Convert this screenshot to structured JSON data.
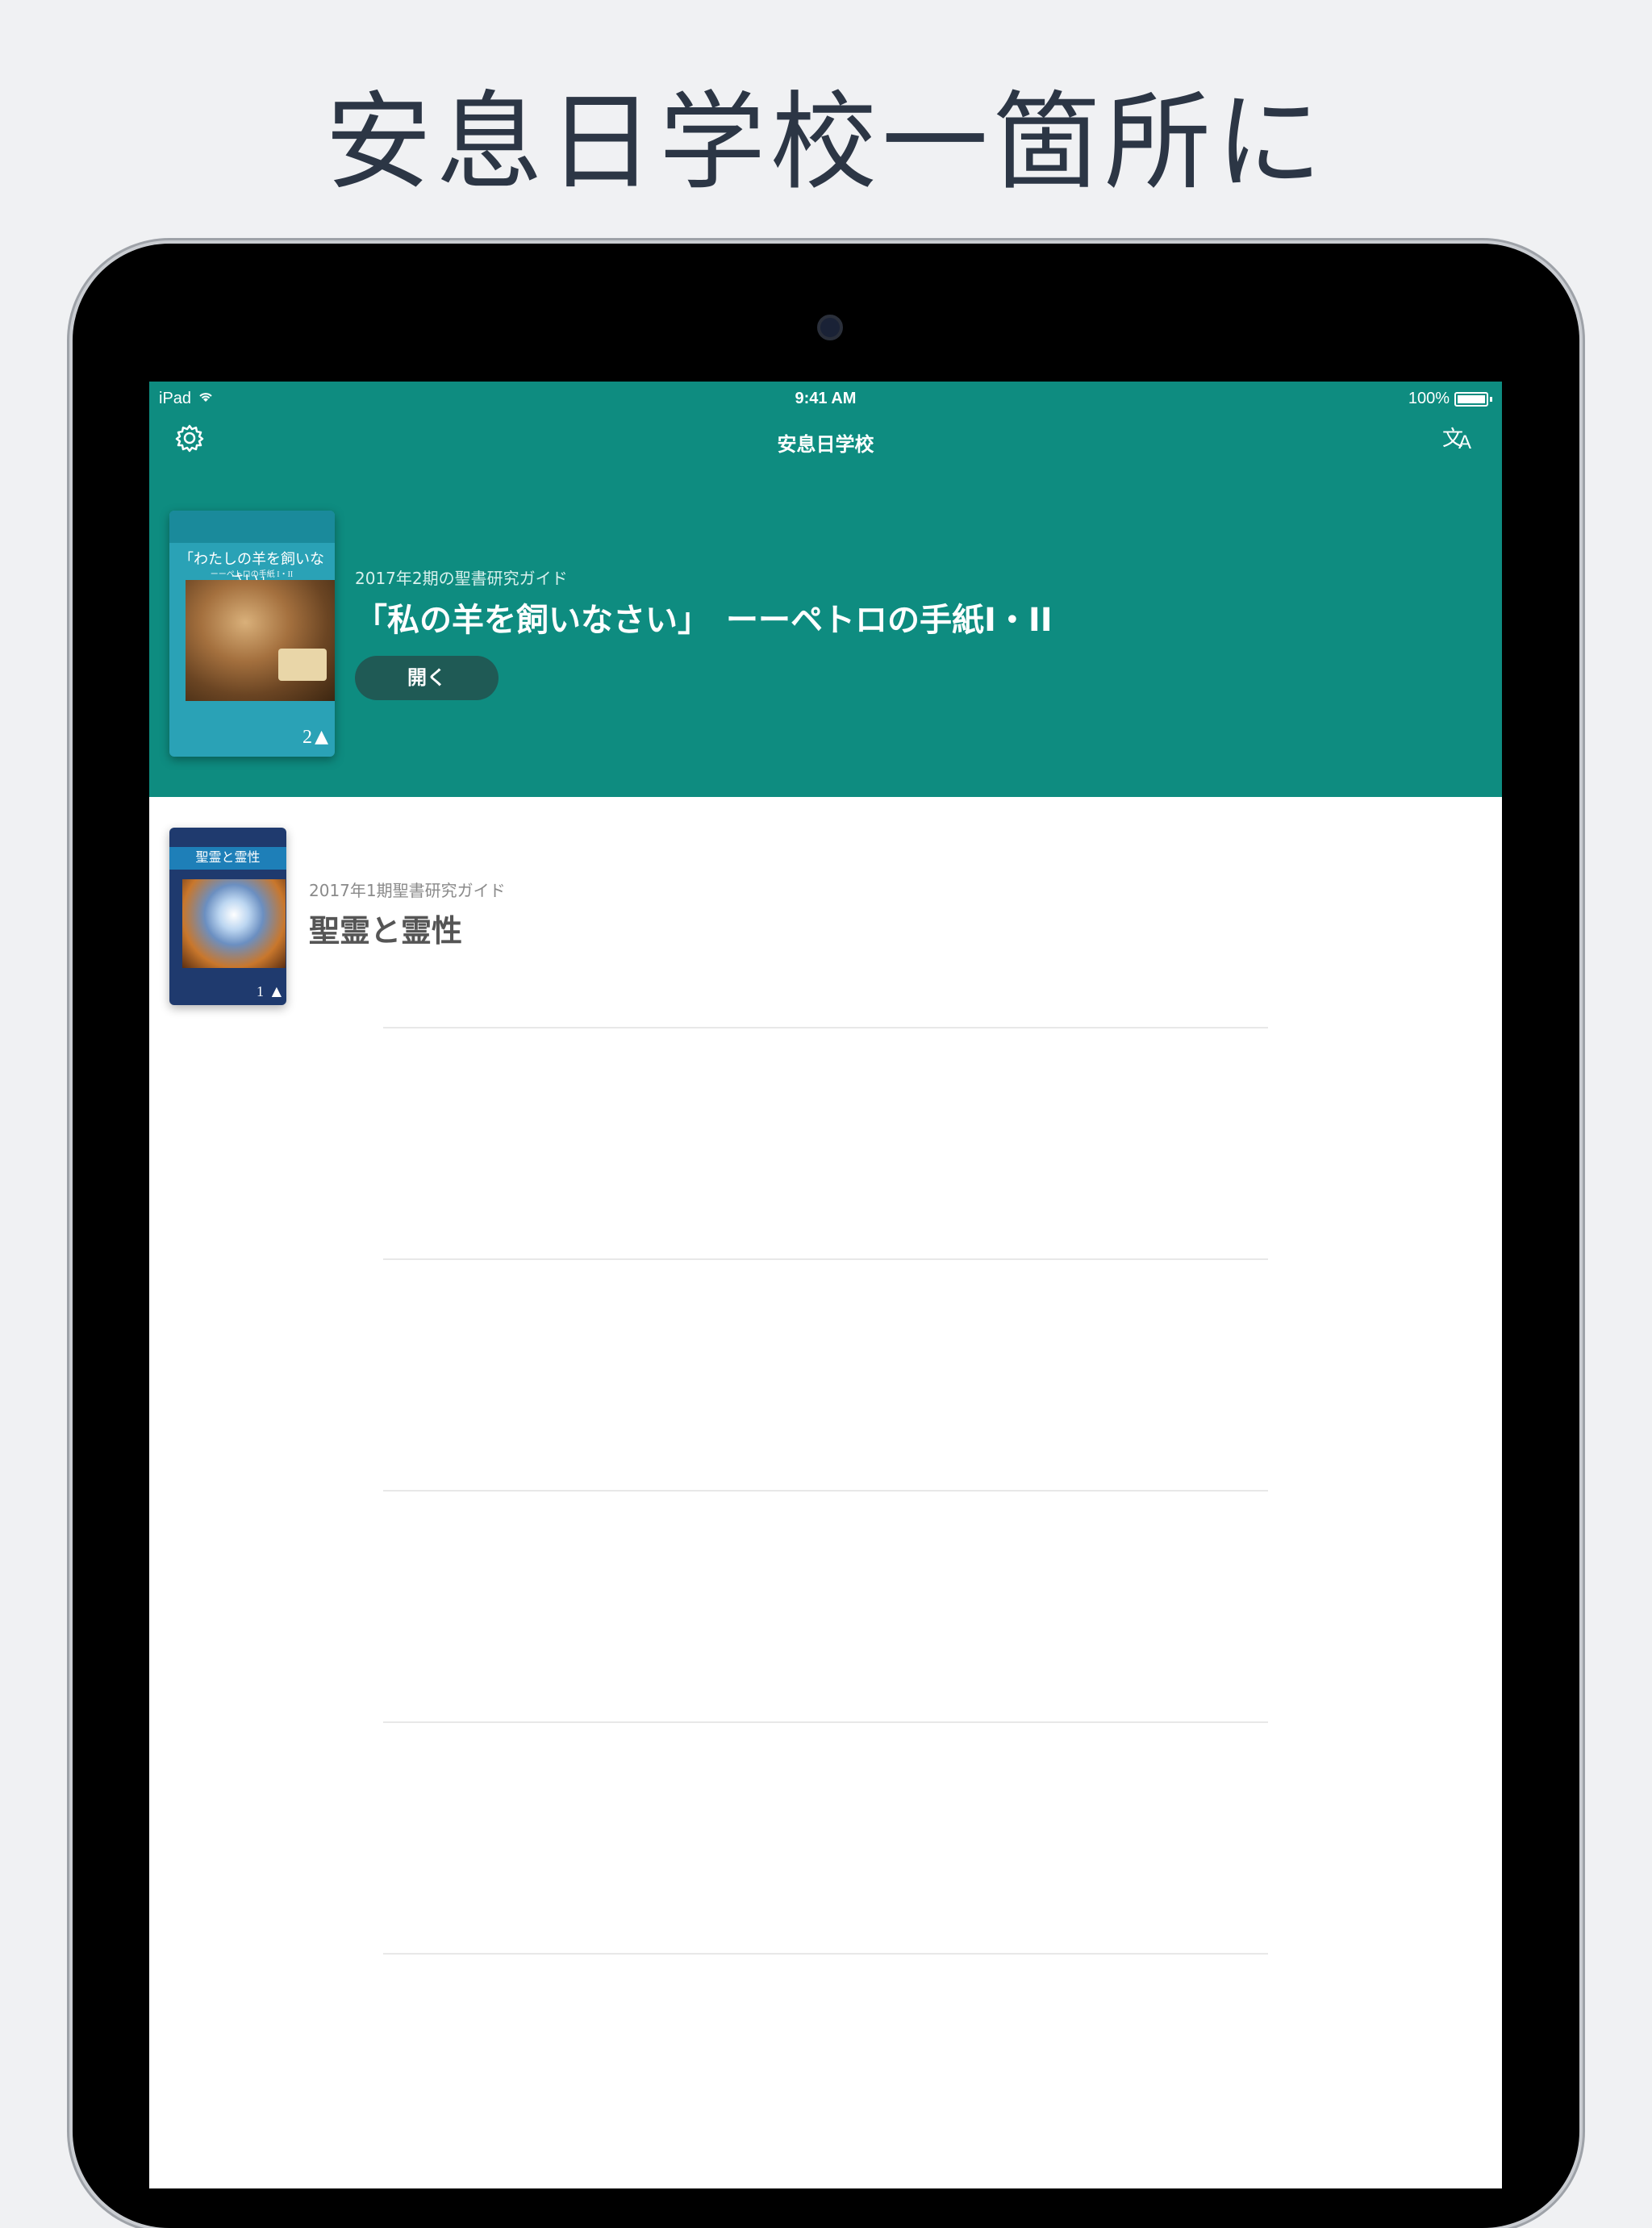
{
  "headline": "安息日学校一箇所に",
  "status_bar": {
    "device": "iPad",
    "time": "9:41 AM",
    "battery": "100%"
  },
  "nav": {
    "title": "安息日学校",
    "settings_icon": "gear-icon",
    "language_icon": "translate-icon",
    "lang_glyph_1": "文",
    "lang_glyph_2": "A"
  },
  "featured": {
    "subtitle": "2017年2期の聖書研究ガイド",
    "title": "「私の羊を飼いなさい」　ーーペトロの手紙I・II",
    "open_label": "開く",
    "cover_title": "「わたしの羊を飼いなさい」",
    "cover_subtitle": "ーーペトロの手紙 I・II",
    "cover_number": "2"
  },
  "quarterlies": [
    {
      "subtitle": "2017年1期聖書研究ガイド",
      "title": "聖霊と霊性",
      "cover_title": "聖霊と霊性",
      "cover_number": "1"
    }
  ],
  "colors": {
    "hero_bg": "#0e8c80",
    "open_button_bg": "#1f5a55",
    "headline": "#2c3645"
  }
}
